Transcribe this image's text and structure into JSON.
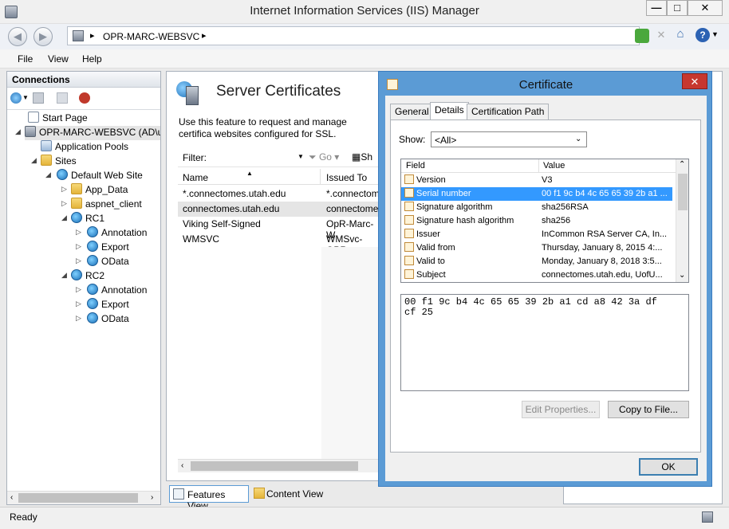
{
  "window": {
    "title": "Internet Information Services (IIS) Manager",
    "minimize": "—",
    "maximize": "□",
    "close": "✕"
  },
  "address": {
    "path": "OPR-MARC-WEBSVC",
    "arrow": "▸"
  },
  "menu": {
    "file": "File",
    "view": "View",
    "help": "Help"
  },
  "connections": {
    "header": "Connections",
    "tree": [
      {
        "label": "Start Page",
        "icon": "page",
        "depth": 0
      },
      {
        "label": "OPR-MARC-WEBSVC (AD\\u0",
        "icon": "server",
        "depth": 0
      },
      {
        "label": "Application Pools",
        "icon": "pool",
        "depth": 1
      },
      {
        "label": "Sites",
        "icon": "folder",
        "depth": 1
      },
      {
        "label": "Default Web Site",
        "icon": "globe",
        "depth": 2
      },
      {
        "label": "App_Data",
        "icon": "folder",
        "depth": 3
      },
      {
        "label": "aspnet_client",
        "icon": "folder",
        "depth": 3
      },
      {
        "label": "RC1",
        "icon": "globe",
        "depth": 3
      },
      {
        "label": "Annotation",
        "icon": "globe",
        "depth": 4
      },
      {
        "label": "Export",
        "icon": "globe",
        "depth": 4
      },
      {
        "label": "OData",
        "icon": "globe",
        "depth": 4
      },
      {
        "label": "RC2",
        "icon": "globe",
        "depth": 3
      },
      {
        "label": "Annotation",
        "icon": "globe",
        "depth": 4
      },
      {
        "label": "Export",
        "icon": "globe",
        "depth": 4
      },
      {
        "label": "OData",
        "icon": "globe",
        "depth": 4
      }
    ]
  },
  "main": {
    "title": "Server Certificates",
    "description": "Use this feature to request and manage certifica websites configured for SSL.",
    "filter_label": "Filter:",
    "go_label": "Go",
    "show_label": "Sh",
    "columns": {
      "name": "Name",
      "issued_to": "Issued To"
    },
    "rows": [
      {
        "name": "*.connectomes.utah.edu",
        "issued_to": "*.connectom"
      },
      {
        "name": "connectomes.utah.edu",
        "issued_to": "connectome"
      },
      {
        "name": "Viking Self-Signed",
        "issued_to": "OpR-Marc-W"
      },
      {
        "name": "WMSVC",
        "issued_to": "WMSvc-OPR"
      }
    ]
  },
  "bottom_tabs": {
    "features_view": "Features View",
    "content_view": "Content View"
  },
  "status": {
    "text": "Ready"
  },
  "dialog": {
    "title": "Certificate",
    "close": "✕",
    "tabs": {
      "general": "General",
      "details": "Details",
      "cert_path": "Certification Path"
    },
    "show_label": "Show:",
    "show_value": "<All>",
    "columns": {
      "field": "Field",
      "value": "Value"
    },
    "fields": [
      {
        "field": "Version",
        "value": "V3"
      },
      {
        "field": "Serial number",
        "value": "00 f1 9c b4 4c 65 65 39 2b a1 ..."
      },
      {
        "field": "Signature algorithm",
        "value": "sha256RSA"
      },
      {
        "field": "Signature hash algorithm",
        "value": "sha256"
      },
      {
        "field": "Issuer",
        "value": "InCommon RSA Server CA, In..."
      },
      {
        "field": "Valid from",
        "value": "Thursday, January 8, 2015 4:..."
      },
      {
        "field": "Valid to",
        "value": "Monday, January 8, 2018 3:5..."
      },
      {
        "field": "Subject",
        "value": "connectomes.utah.edu, UofU..."
      }
    ],
    "selected_index": 1,
    "detail_line1": "00 f1 9c b4 4c 65 65 39 2b a1 cd a8 42 3a df",
    "detail_line2": "cf 25",
    "edit_properties": "Edit Properties...",
    "copy_to_file": "Copy to File...",
    "ok": "OK"
  },
  "colors": {
    "selection": "#3399ff",
    "dialog_frame": "#5b9bd5",
    "row_hover": "#e5f3fb"
  }
}
